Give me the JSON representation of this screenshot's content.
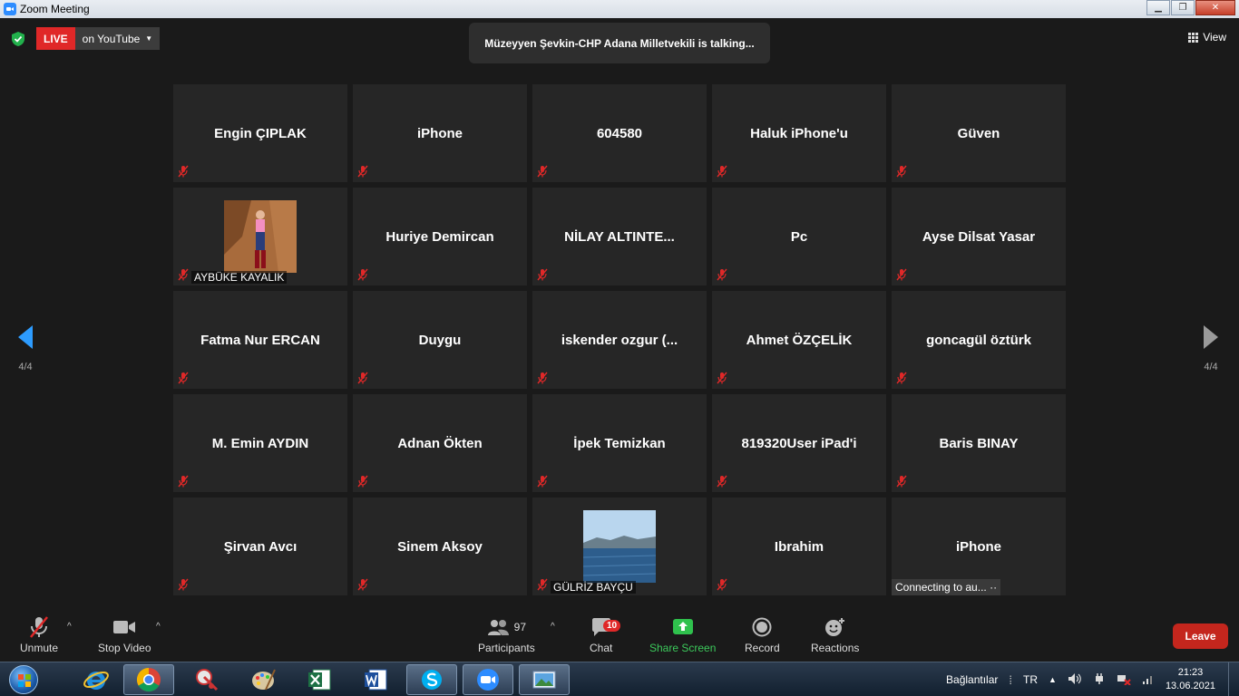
{
  "window": {
    "title": "Zoom Meeting"
  },
  "topbar": {
    "live_label": "LIVE",
    "stream_target": "on YouTube",
    "talking": "Müzeyyen Şevkin-CHP Adana Milletvekili is talking...",
    "view_label": "View"
  },
  "pager": {
    "left": "4/4",
    "right": "4/4"
  },
  "tiles": [
    {
      "name": "Engin ÇIPLAK"
    },
    {
      "name": "iPhone"
    },
    {
      "name": "604580"
    },
    {
      "name": "Haluk iPhone'u"
    },
    {
      "name": "Güven"
    },
    {
      "name": "AYBÜKE KAYALIK"
    },
    {
      "name": "Huriye Demircan"
    },
    {
      "name": "NİLAY ALTINTE..."
    },
    {
      "name": "Pc"
    },
    {
      "name": "Ayse Dilsat Yasar"
    },
    {
      "name": "Fatma Nur ERCAN"
    },
    {
      "name": "Duygu"
    },
    {
      "name": "iskender ozgur (..."
    },
    {
      "name": "Ahmet ÖZÇELİK"
    },
    {
      "name": "goncagül öztürk"
    },
    {
      "name": "M. Emin AYDIN"
    },
    {
      "name": "Adnan Ökten"
    },
    {
      "name": "İpek Temizkan"
    },
    {
      "name": "819320User iPad'i"
    },
    {
      "name": "Baris BINAY"
    },
    {
      "name": "Şirvan Avcı"
    },
    {
      "name": "Sinem Aksoy"
    },
    {
      "name": "GÜLRİZ BAYÇU"
    },
    {
      "name": "Ibrahim"
    },
    {
      "name": "iPhone",
      "status": "Connecting to au... ··"
    }
  ],
  "toolbar": {
    "unmute": "Unmute",
    "stop_video": "Stop Video",
    "participants": "Participants",
    "participants_count": "97",
    "chat": "Chat",
    "chat_badge": "10",
    "share_screen": "Share Screen",
    "record": "Record",
    "reactions": "Reactions",
    "leave": "Leave"
  },
  "taskbar": {
    "tray_connections": "Bağlantılar",
    "tray_lang": "TR",
    "time": "21:23",
    "date": "13.06.2021"
  },
  "colors": {
    "live": "#e02828",
    "share_green": "#3cc95b",
    "leave_red": "#c4261d",
    "pager_blue": "#2d9cff",
    "mute_red": "#e02828"
  }
}
